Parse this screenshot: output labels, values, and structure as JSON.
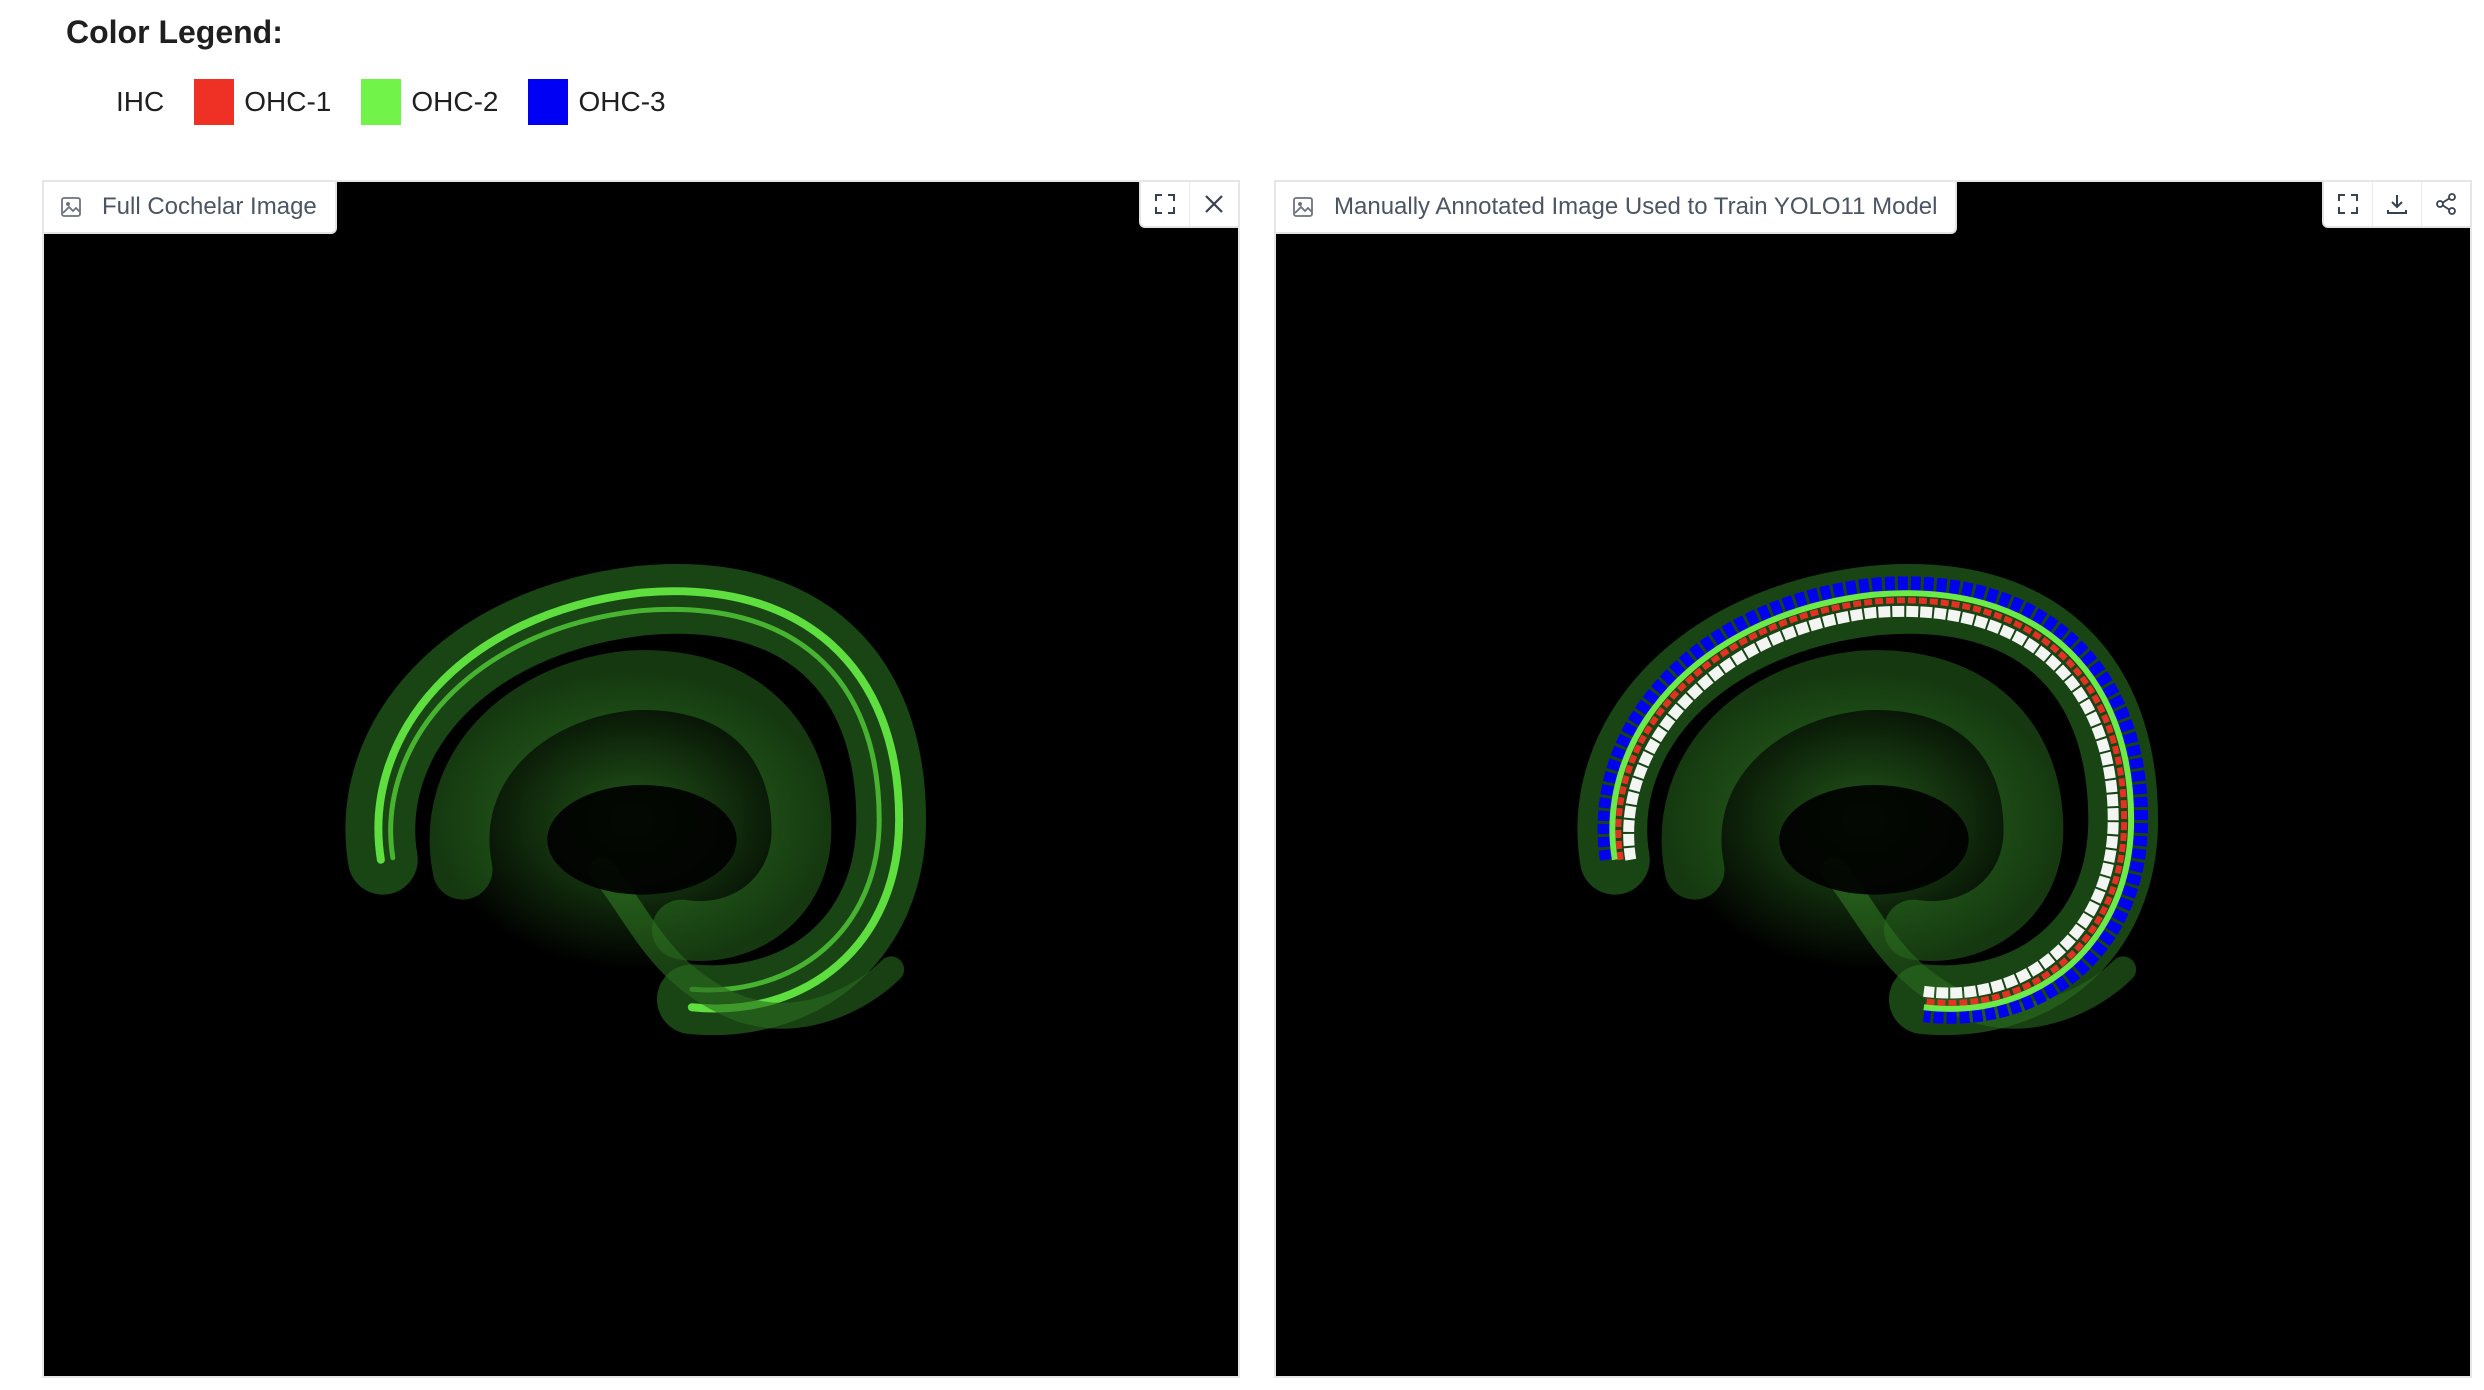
{
  "legend": {
    "title": "Color Legend:",
    "items": [
      {
        "label": "IHC",
        "color": "#ffffff"
      },
      {
        "label": "OHC-1",
        "color": "#ee3124"
      },
      {
        "label": "OHC-2",
        "color": "#71f34a"
      },
      {
        "label": "OHC-3",
        "color": "#0000f5"
      }
    ]
  },
  "panels": {
    "left": {
      "label": "Full Cochelar Image",
      "tools": [
        "fullscreen-icon",
        "close-icon"
      ]
    },
    "right": {
      "label": "Manually Annotated Image Used to Train YOLO11 Model",
      "tools": [
        "fullscreen-icon",
        "download-icon",
        "share-icon"
      ]
    }
  },
  "colors": {
    "tissue_green": "#3fa12e",
    "bright_green": "#66ee44",
    "ihc_white": "#ffffff",
    "ohc1_red": "#ee3124",
    "ohc3_blue": "#0000f5",
    "panel_background": "#000000"
  }
}
